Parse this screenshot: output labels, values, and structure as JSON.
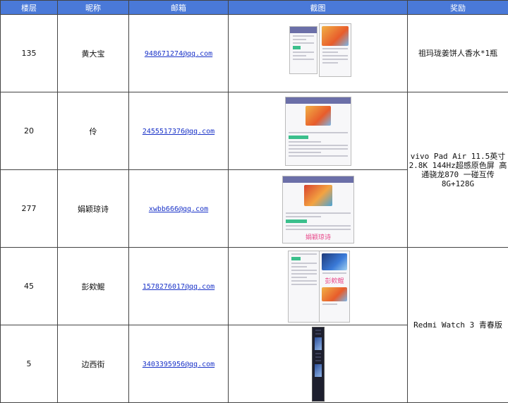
{
  "headers": {
    "floor": "楼层",
    "nickname": "昵称",
    "email": "邮箱",
    "screenshot": "截图",
    "reward": "奖励"
  },
  "rows": [
    {
      "floor": "135",
      "nickname": "黄大宝",
      "email": "948671274@qq.com",
      "reward": "祖玛珑姜饼人香水*1瓶"
    },
    {
      "floor": "20",
      "nickname": "伶",
      "email": "2455517376@qq.com"
    },
    {
      "floor": "277",
      "nickname": "娟颖琼诗",
      "email": "xwbb666@qq.com",
      "shot_caption": "娟颖琼诗"
    },
    {
      "floor": "45",
      "nickname": "彭欸鲲",
      "email": "1578276017@qq.com",
      "shot_caption": "彭欸鲲"
    },
    {
      "floor": "5",
      "nickname": "边西街",
      "email": "3403395956@qq.com"
    }
  ],
  "rewards": {
    "vivo": "vivo Pad Air 11.5英寸 2.8K 144Hz超感原色屏 高通骁龙870 一碰互传 8G+128G",
    "redmi": "Redmi Watch 3 青春版"
  }
}
